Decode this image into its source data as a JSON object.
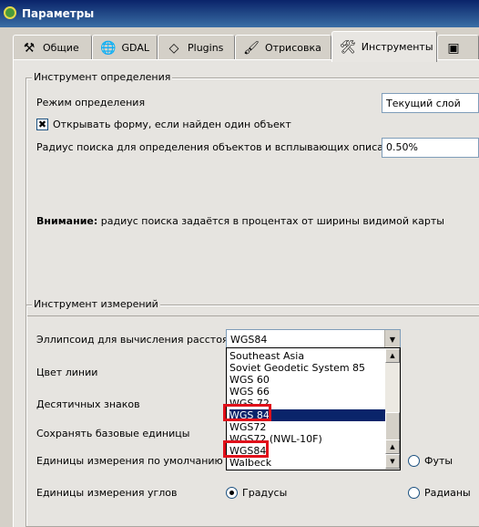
{
  "window": {
    "title": "Параметры"
  },
  "tabs": [
    {
      "label": "Общие",
      "icon": "tools-icon"
    },
    {
      "label": "GDAL",
      "icon": "gdal-icon"
    },
    {
      "label": "Plugins",
      "icon": "plugin-icon"
    },
    {
      "label": "Отрисовка",
      "icon": "brush-icon"
    },
    {
      "label": "Инструменты",
      "icon": "toolbox-icon",
      "active": true
    }
  ],
  "identify": {
    "group_title": "Инструмент определения",
    "mode_label": "Режим определения",
    "mode_value": "Текущий слой",
    "open_form_label": "Открывать форму, если найден один объект",
    "open_form_checked": true,
    "radius_label": "Радиус поиска для определения объектов и всплывающих описаний",
    "radius_value": "0.50%",
    "note_bold": "Внимание:",
    "note_text": " радиус поиска задаётся в процентах от ширины видимой карты"
  },
  "measure": {
    "group_title": "Инструмент измерений",
    "ellipsoid_label": "Эллипсоид для вычисления расстояний",
    "ellipsoid_value": "WGS84",
    "line_color_label": "Цвет линии",
    "decimals_label": "Десятичных знаков",
    "keep_units_label": "Сохранять базовые единицы",
    "default_units_label": "Единицы измерения по умолчанию",
    "feet_label": "Футы",
    "angle_units_label": "Единицы измерения углов",
    "degrees_label": "Градусы",
    "radians_label": "Радианы"
  },
  "ellipsoid_options": [
    "Southeast Asia",
    "Soviet Geodetic System 85",
    "WGS 60",
    "WGS 66",
    "WGS 72",
    "WGS 84",
    "WGS72",
    "WGS72 (NWL-10F)",
    "WGS84",
    "Walbeck"
  ],
  "selected_option": "WGS 84",
  "colors": {
    "highlight_box": "#e0101a",
    "selection": "#0a246a"
  }
}
